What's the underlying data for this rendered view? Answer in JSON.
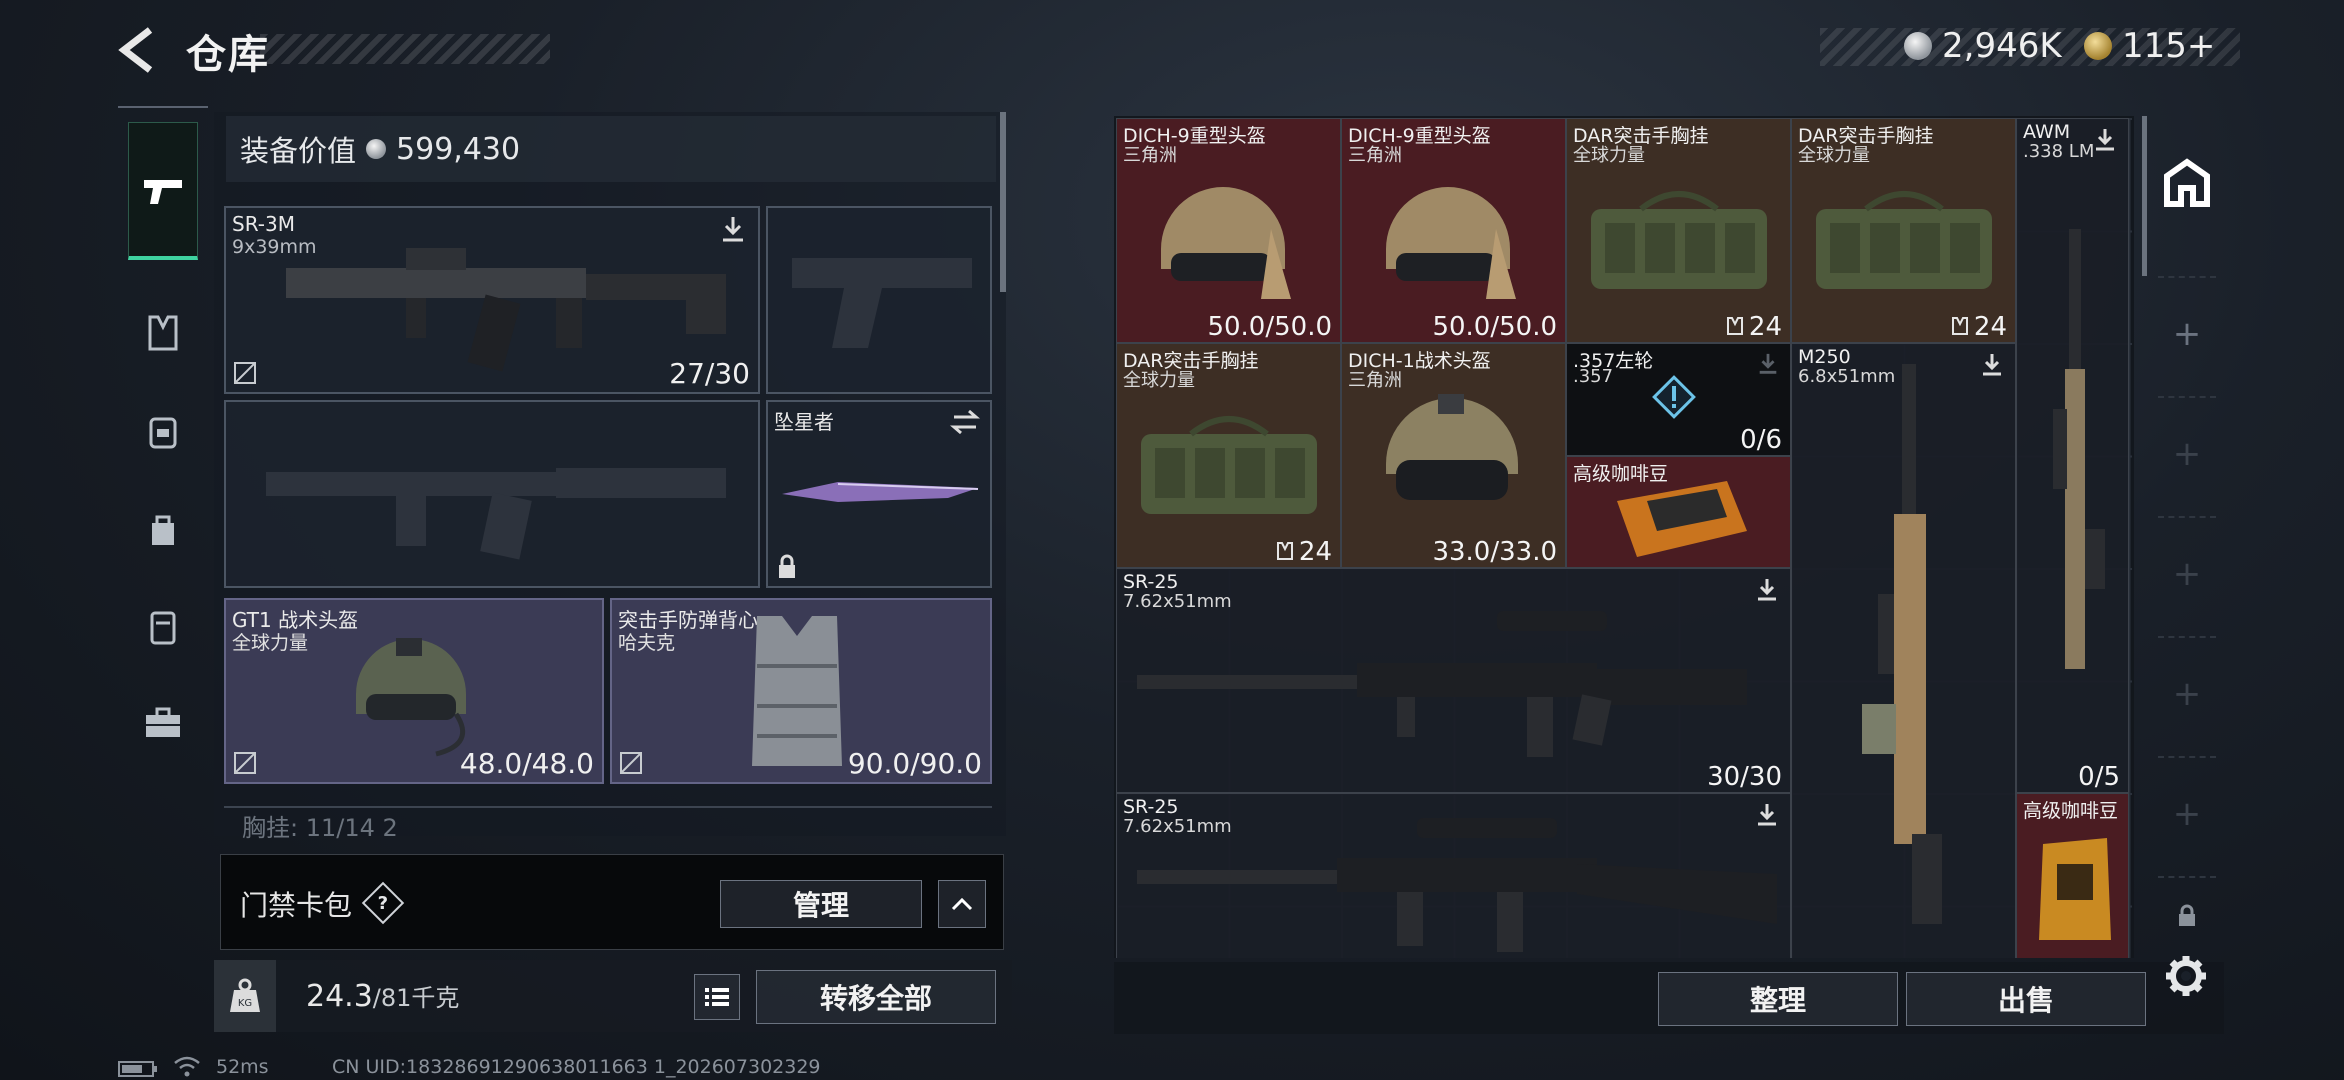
{
  "header": {
    "title": "仓库",
    "silver": "2,946K",
    "gold": "115+"
  },
  "left": {
    "value_label": "装备价值",
    "value": "599,430",
    "weapon1": {
      "name": "SR-3M",
      "caliber": "9x39mm",
      "ammo": "27/30"
    },
    "melee": {
      "name": "坠星者"
    },
    "helmet": {
      "name": "GT1 战术头盔",
      "maker": "全球力量",
      "durability": "48.0/48.0"
    },
    "armor": {
      "name": "突击手防弹背心",
      "maker": "哈夫克",
      "durability": "90.0/90.0"
    },
    "chest_peek": "胸挂: 11/14  2",
    "card_label": "门禁卡包",
    "card_help": "?",
    "manage": "管理",
    "weight": "24.3",
    "weight_max": "/81千克",
    "transfer": "转移全部"
  },
  "status": {
    "ping": "52ms",
    "uid": "CN UID:18328691290638011663 1_202607302329"
  },
  "grid": {
    "items": [
      {
        "t1": "DICH-9重型头盔",
        "t2": "三角洲",
        "cnt": "50.0/50.0"
      },
      {
        "t1": "DICH-9重型头盔",
        "t2": "三角洲",
        "cnt": "50.0/50.0"
      },
      {
        "t1": "DAR突击手胸挂",
        "t2": "全球力量",
        "cnt": "24"
      },
      {
        "t1": "DAR突击手胸挂",
        "t2": "全球力量",
        "cnt": "24"
      },
      {
        "t1": "AWM",
        "t2": ".338 LM",
        "cnt": "0/5"
      },
      {
        "t1": "DAR突击手胸挂",
        "t2": "全球力量",
        "cnt": "24"
      },
      {
        "t1": "DICH-1战术头盔",
        "t2": "三角洲",
        "cnt": "33.0/33.0"
      },
      {
        "t1": ".357左轮",
        "t2": ".357",
        "cnt": "0/6"
      },
      {
        "t1": "M250",
        "t2": "6.8x51mm",
        "cnt": ""
      },
      {
        "t1": "高级咖啡豆",
        "t2": "",
        "cnt": ""
      },
      {
        "t1": "SR-25",
        "t2": "7.62x51mm",
        "cnt": "30/30"
      },
      {
        "t1": "SR-25",
        "t2": "7.62x51mm",
        "cnt": ""
      },
      {
        "t1": "高级咖啡豆",
        "t2": "",
        "cnt": ""
      }
    ]
  },
  "bottom": {
    "sort": "整理",
    "sell": "出售"
  },
  "colors": {
    "accent": "#3fd3a0",
    "red_cell": "#4a1c22",
    "brown_cell": "#3d2e24",
    "purple_slot": "#3b3b55"
  }
}
